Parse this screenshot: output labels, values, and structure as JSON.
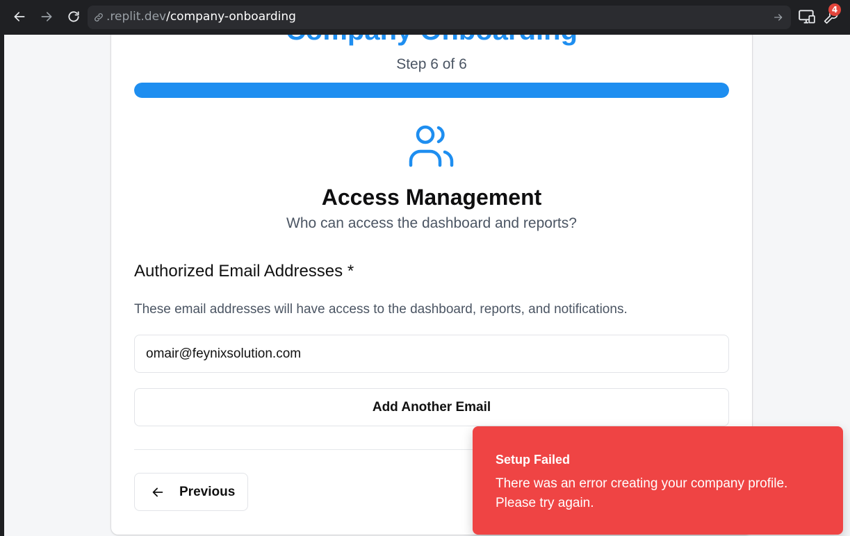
{
  "browser": {
    "url_domain": ".replit.dev",
    "url_path": "/company-onboarding",
    "extension_badge": "4"
  },
  "page": {
    "title": "Company Onboarding",
    "step_text": "Step 6 of 6",
    "progress_fraction": 1.0,
    "accent_color": "#1e8ef0",
    "section_icon": "users-icon",
    "section_title": "Access Management",
    "section_subtitle": "Who can access the dashboard and reports?",
    "field_label": "Authorized Email Addresses *",
    "field_help": "These email addresses will have access to the dashboard, reports, and notifications.",
    "email_value": "omair@feynixsolution.com",
    "add_email_label": "Add Another Email",
    "previous_label": "Previous"
  },
  "toast": {
    "title": "Setup Failed",
    "message": "There was an error creating your company profile. Please try again.",
    "color": "#ef4444"
  }
}
